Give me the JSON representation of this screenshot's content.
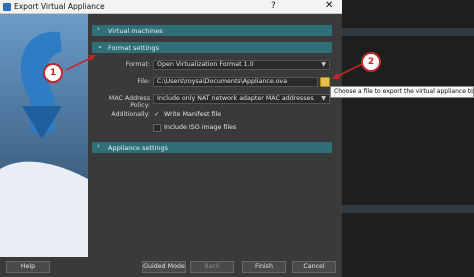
{
  "window": {
    "title": "Export Virtual Appliance",
    "help_glyph": "?",
    "close_glyph": "✕"
  },
  "sections": [
    {
      "label": "Virtual machines",
      "chevron": "›"
    },
    {
      "label": "Format settings",
      "chevron": "⌄"
    },
    {
      "label": "Appliance settings",
      "chevron": "›"
    }
  ],
  "format_settings": {
    "format_label": "Format:",
    "format_value": "Open Virtualization Format 1.0",
    "file_label": "File:",
    "file_value": "C:\\Users\\roysa\\Documents\\Appliance.ova",
    "mac_label": "MAC Address Policy:",
    "mac_value": "Include only NAT network adapter MAC addresses",
    "additionally_label": "Additionally:",
    "write_manifest_label": "Write Manifest file",
    "write_manifest_checked": true,
    "include_iso_label": "Include ISO image files",
    "include_iso_checked": false
  },
  "tooltip": {
    "text": "Choose a file to export the virtual appliance to..."
  },
  "annotations": [
    {
      "number": "1"
    },
    {
      "number": "2"
    }
  ],
  "buttons": {
    "help": "Help",
    "guided_mode": "Guided Mode",
    "back": "Back",
    "finish": "Finish",
    "cancel": "Cancel"
  },
  "colors": {
    "section_header": "#2f6f78",
    "marker": "#c0272d",
    "folder": "#e2c14a"
  },
  "icons": [
    "app-icon",
    "help-icon",
    "close-icon",
    "chevron-right-icon",
    "chevron-down-icon",
    "folder-icon",
    "checkmark-icon"
  ]
}
